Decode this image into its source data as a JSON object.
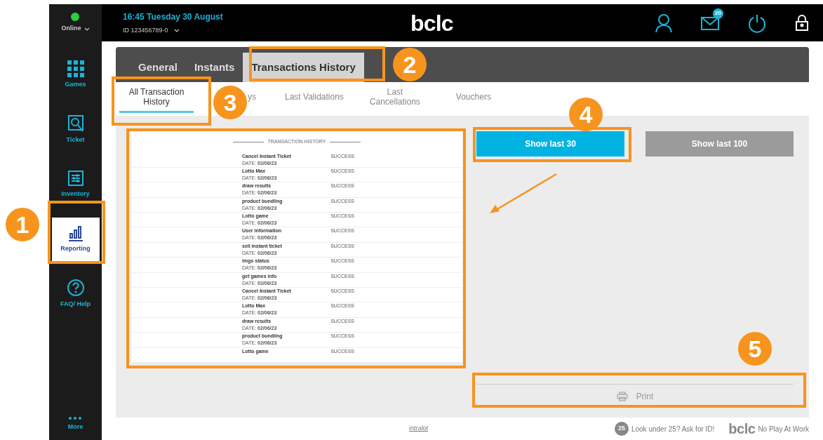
{
  "status": {
    "online": true,
    "label": "Online"
  },
  "header": {
    "time": "16:45 Tuesday 30 August",
    "terminal_id": "ID 123456789-0",
    "logo": "bclc",
    "mail_badge": "20"
  },
  "sidebar": {
    "items": [
      {
        "label": "Games",
        "selected": false
      },
      {
        "label": "Ticket",
        "selected": false
      },
      {
        "label": "Inventory",
        "selected": false
      },
      {
        "label": "Reporting",
        "selected": true
      },
      {
        "label": "FAQ/ Help",
        "selected": false
      }
    ],
    "more": "More"
  },
  "tabs": [
    {
      "label": "General",
      "selected": false
    },
    {
      "label": "Instants",
      "selected": false
    },
    {
      "label": "Transactions History",
      "selected": true
    }
  ],
  "subtabs": [
    {
      "label": "All Transaction History",
      "selected": true
    },
    {
      "label": "ys",
      "selected": false
    },
    {
      "label": "Last Validations",
      "selected": false
    },
    {
      "label": "Last Cancellations",
      "selected": false
    },
    {
      "label": "Vouchers",
      "selected": false
    }
  ],
  "receipt": {
    "title": "TRANSACTION HISTORY",
    "rows": [
      {
        "name": "Cancel Instant Ticket",
        "date": "DATE: **02/06/23**",
        "status": "SUCCESS"
      },
      {
        "name": "Lotto Max",
        "date": "DATE: **02/06/23**",
        "status": "SUCCESS"
      },
      {
        "name": "draw results",
        "date": "DATE: **02/06/23**",
        "status": "SUCCESS"
      },
      {
        "name": "product bundling",
        "date": "DATE: **02/06/23**",
        "status": "SUCCESS"
      },
      {
        "name": "Lotto game",
        "date": "DATE: **02/06/23**",
        "status": "SUCCESS"
      },
      {
        "name": "User information",
        "date": "DATE: **02/06/23**",
        "status": "SUCCESS"
      },
      {
        "name": "sell instant ticket",
        "date": "DATE: **02/06/23**",
        "status": "SUCCESS"
      },
      {
        "name": "imgs status",
        "date": "DATE: **02/06/23**",
        "status": "SUCCESS"
      },
      {
        "name": "get games info",
        "date": "DATE: **02/06/23**",
        "status": "SUCCESS"
      },
      {
        "name": "Cancel Instant Ticket",
        "date": "DATE: **02/06/23**",
        "status": "SUCCESS"
      },
      {
        "name": "Lotto Max",
        "date": "DATE: **02/06/23**",
        "status": "SUCCESS"
      },
      {
        "name": "draw results",
        "date": "DATE: **02/06/23**",
        "status": "SUCCESS"
      },
      {
        "name": "product bundling",
        "date": "DATE: **02/06/23**",
        "status": "SUCCESS"
      },
      {
        "name": "Lotto game",
        "status": "SUCCESS"
      }
    ]
  },
  "buttons": [
    {
      "label": "Show last 30",
      "selected": true
    },
    {
      "label": "Show last 100",
      "selected": false
    }
  ],
  "print": "Print",
  "footer": {
    "vendor": "intralot",
    "age_badge": "25",
    "age_text": "Look under 25? Ask for ID!",
    "logo": "bclc",
    "slogan": "No Play At Work"
  },
  "callouts": [
    {
      "number": "1"
    },
    {
      "number": "2"
    },
    {
      "number": "3"
    },
    {
      "number": "4"
    },
    {
      "number": "5"
    }
  ]
}
